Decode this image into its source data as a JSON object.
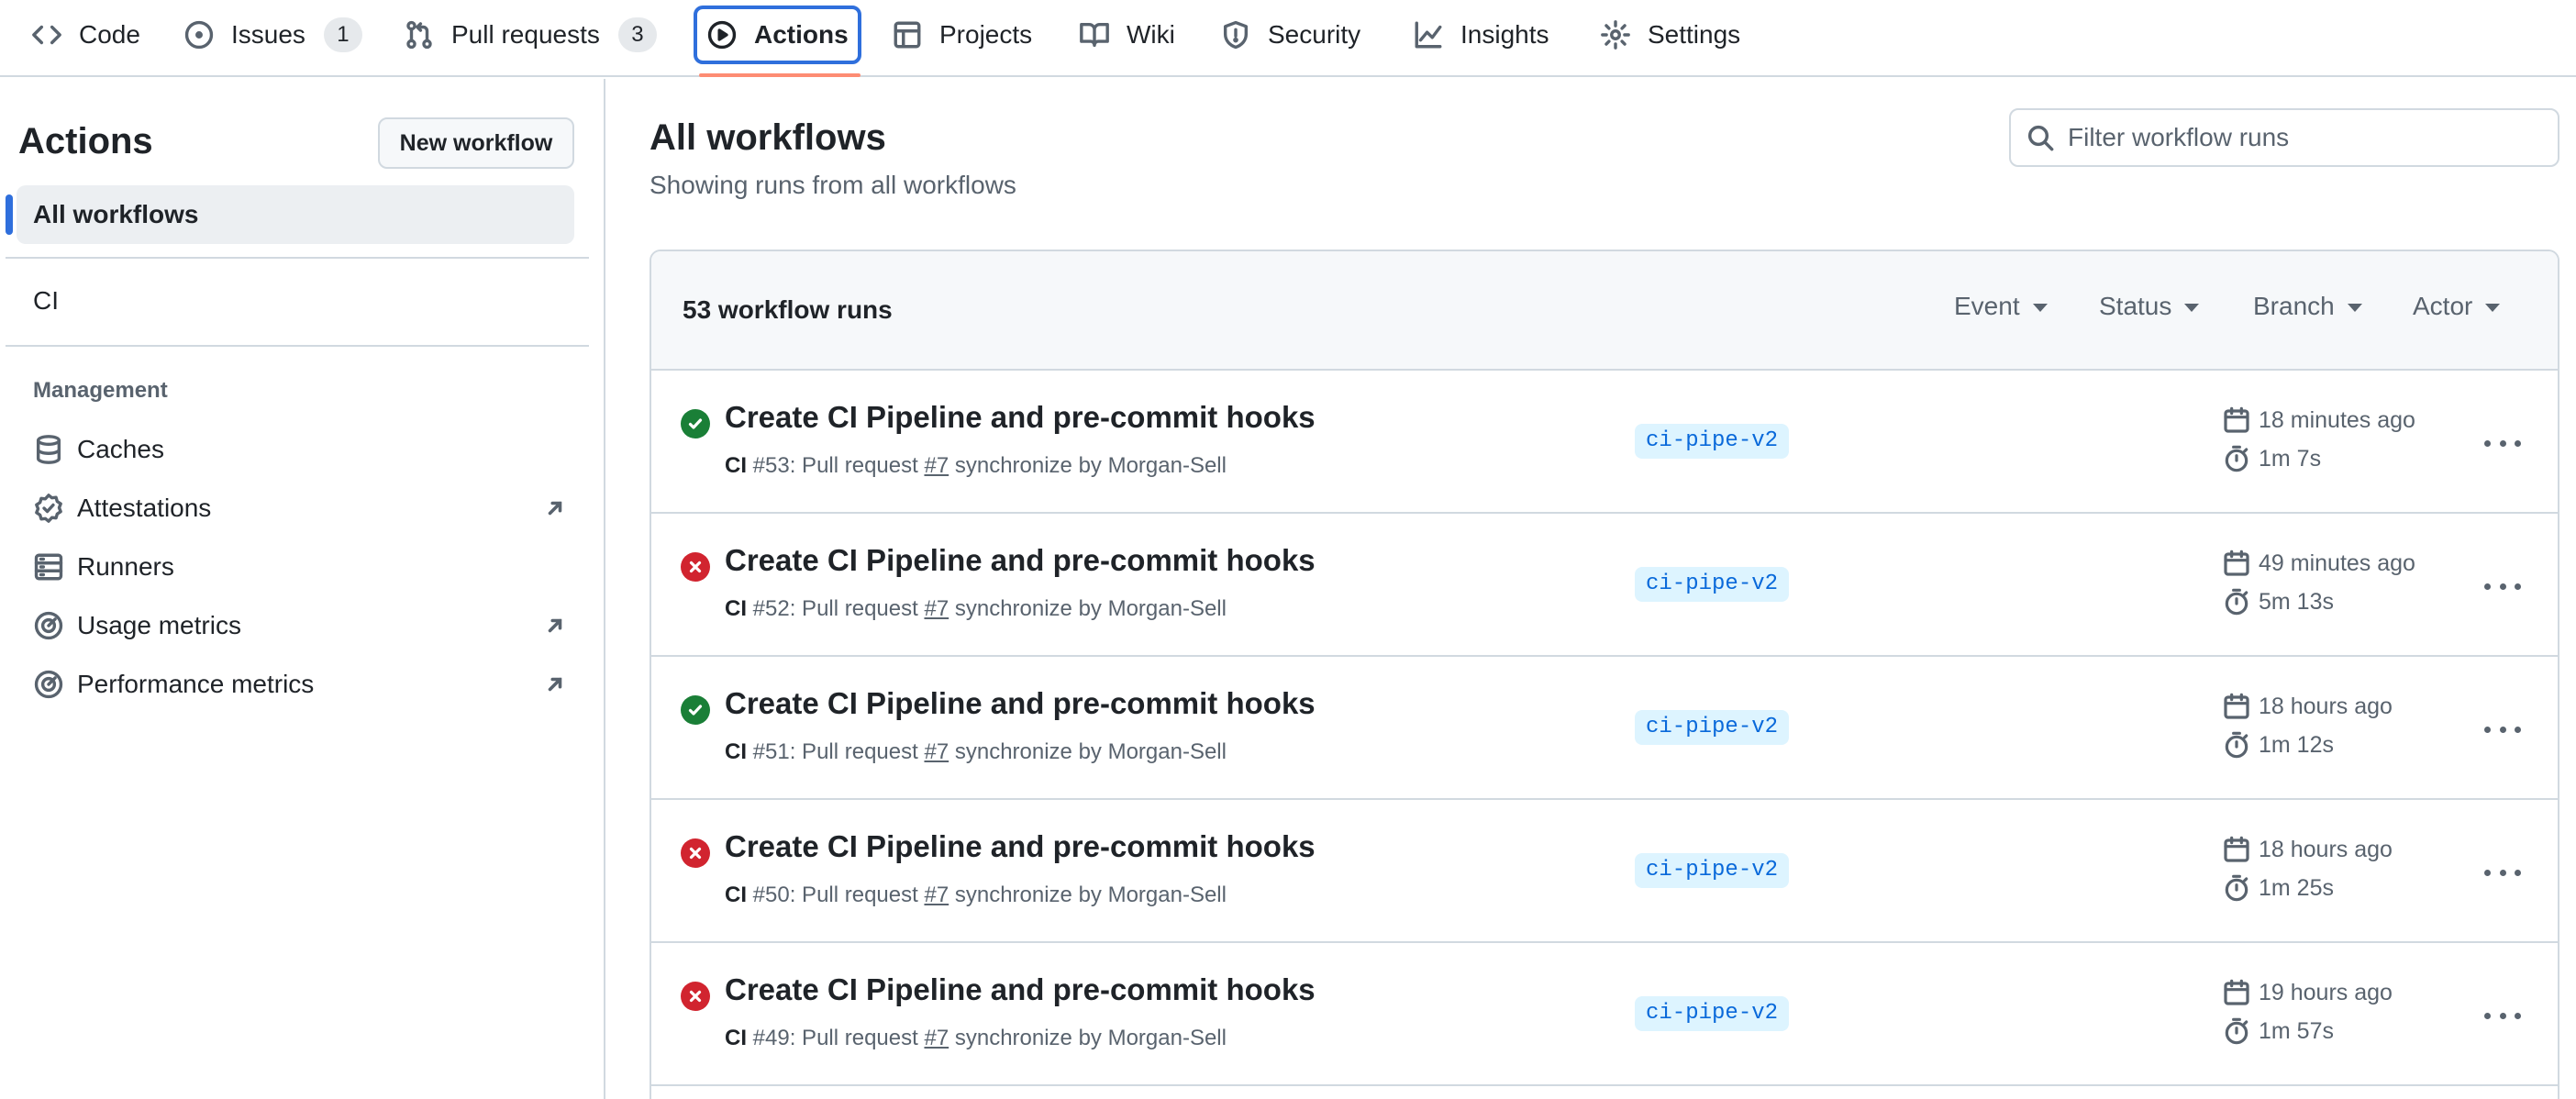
{
  "nav": {
    "tabs": [
      {
        "label": "Code",
        "icon": "code-icon"
      },
      {
        "label": "Issues",
        "icon": "issue-icon",
        "counter": "1"
      },
      {
        "label": "Pull requests",
        "icon": "pull-request-icon",
        "counter": "3"
      },
      {
        "label": "Actions",
        "icon": "play-icon",
        "active": true
      },
      {
        "label": "Projects",
        "icon": "table-icon"
      },
      {
        "label": "Wiki",
        "icon": "book-icon"
      },
      {
        "label": "Security",
        "icon": "shield-icon"
      },
      {
        "label": "Insights",
        "icon": "graph-icon"
      },
      {
        "label": "Settings",
        "icon": "gear-icon"
      }
    ],
    "accent_color": "#fd8c73",
    "focus_color": "#2f6fdc"
  },
  "sidebar": {
    "title": "Actions",
    "new_workflow_label": "New workflow",
    "all_workflows_label": "All workflows",
    "workflows": [
      "CI"
    ],
    "management_heading": "Management",
    "management_items": [
      {
        "label": "Caches",
        "icon": "database-icon",
        "external": false
      },
      {
        "label": "Attestations",
        "icon": "verified-icon",
        "external": true
      },
      {
        "label": "Runners",
        "icon": "server-icon",
        "external": false
      },
      {
        "label": "Usage metrics",
        "icon": "meter-icon",
        "external": true
      },
      {
        "label": "Performance metrics",
        "icon": "meter-icon",
        "external": true
      }
    ]
  },
  "main": {
    "title": "All workflows",
    "subtitle": "Showing runs from all workflows",
    "filter_placeholder": "Filter workflow runs",
    "run_count_label": "53 workflow runs",
    "filters": [
      "Event",
      "Status",
      "Branch",
      "Actor"
    ],
    "runs": [
      {
        "status": "success",
        "title": "Create CI Pipeline and pre-commit hooks",
        "workflow": "CI",
        "number": "#53",
        "event_text": ": Pull request ",
        "pr": "#7",
        "action_text": " synchronize by Morgan-Sell",
        "branch": "ci-pipe-v2",
        "time_ago": "18 minutes ago",
        "duration": "1m 7s"
      },
      {
        "status": "failure",
        "title": "Create CI Pipeline and pre-commit hooks",
        "workflow": "CI",
        "number": "#52",
        "event_text": ": Pull request ",
        "pr": "#7",
        "action_text": " synchronize by Morgan-Sell",
        "branch": "ci-pipe-v2",
        "time_ago": "49 minutes ago",
        "duration": "5m 13s"
      },
      {
        "status": "success",
        "title": "Create CI Pipeline and pre-commit hooks",
        "workflow": "CI",
        "number": "#51",
        "event_text": ": Pull request ",
        "pr": "#7",
        "action_text": " synchronize by Morgan-Sell",
        "branch": "ci-pipe-v2",
        "time_ago": "18 hours ago",
        "duration": "1m 12s"
      },
      {
        "status": "failure",
        "title": "Create CI Pipeline and pre-commit hooks",
        "workflow": "CI",
        "number": "#50",
        "event_text": ": Pull request ",
        "pr": "#7",
        "action_text": " synchronize by Morgan-Sell",
        "branch": "ci-pipe-v2",
        "time_ago": "18 hours ago",
        "duration": "1m 25s"
      },
      {
        "status": "failure",
        "title": "Create CI Pipeline and pre-commit hooks",
        "workflow": "CI",
        "number": "#49",
        "event_text": ": Pull request ",
        "pr": "#7",
        "action_text": " synchronize by Morgan-Sell",
        "branch": "ci-pipe-v2",
        "time_ago": "19 hours ago",
        "duration": "1m 57s"
      }
    ],
    "colors": {
      "success": "#1a7f37",
      "failure": "#d1242f",
      "branch_bg": "#ddf4ff",
      "branch_text": "#0969da"
    }
  }
}
